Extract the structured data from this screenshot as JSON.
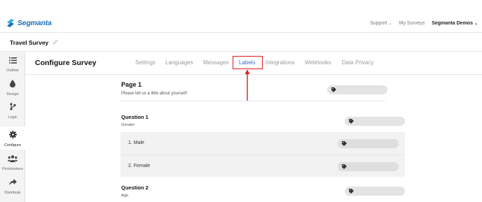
{
  "brand": {
    "name": "Segmanta",
    "color": "#1d6fb8"
  },
  "topnav": {
    "support": "Support",
    "my_surveys": "My Surveys",
    "account": "Segmanta Demos"
  },
  "survey": {
    "title": "Travel Survey"
  },
  "sidebar": {
    "items": [
      {
        "label": "Outline",
        "icon": "list-icon"
      },
      {
        "label": "Design",
        "icon": "droplet-icon"
      },
      {
        "label": "Logic",
        "icon": "branch-icon"
      },
      {
        "label": "Configure",
        "icon": "gear-icon",
        "active": true
      },
      {
        "label": "Permissions",
        "icon": "users-icon"
      },
      {
        "label": "Distribute",
        "icon": "share-icon"
      }
    ]
  },
  "configure": {
    "title": "Configure Survey",
    "tabs": [
      {
        "label": "Settings"
      },
      {
        "label": "Languages"
      },
      {
        "label": "Messages"
      },
      {
        "label": "Labels",
        "active": true
      },
      {
        "label": "Integrations"
      },
      {
        "label": "Webhooks"
      },
      {
        "label": "Data Privacy"
      }
    ],
    "active_tab_color": "#3b6fd8",
    "highlight_color": "#e01919"
  },
  "content": {
    "page": {
      "title": "Page 1",
      "description": "Please tell us a little about yourself!"
    },
    "questions": [
      {
        "title": "Question 1",
        "subtitle": "Gender",
        "answers": [
          "1. Male",
          "2. Female"
        ]
      },
      {
        "title": "Question 2",
        "subtitle": "Age"
      }
    ]
  }
}
